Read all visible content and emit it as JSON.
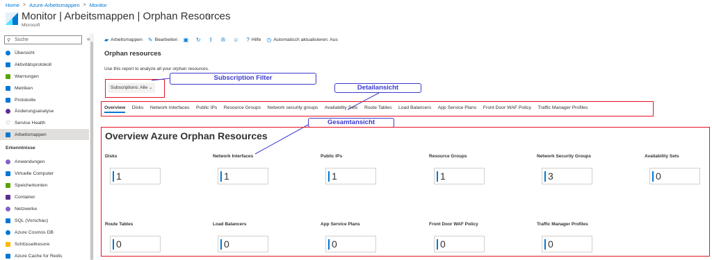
{
  "breadcrumb": [
    "Home",
    "Azure-Arbeitsmappen",
    "Monitor"
  ],
  "header": {
    "title": "Monitor | Arbeitsmappen | Orphan Resources",
    "subtitle": "Microsoft"
  },
  "sidebar": {
    "search_placeholder": "Suche",
    "items": [
      {
        "label": "Übersicht",
        "icon": "overview-icon",
        "color": "#0078d4"
      },
      {
        "label": "Aktivitätsprotokoll",
        "icon": "activity-log-icon",
        "color": "#0078d4"
      },
      {
        "label": "Warnungen",
        "icon": "alerts-icon",
        "color": "#57a300"
      },
      {
        "label": "Metriken",
        "icon": "metrics-icon",
        "color": "#0078d4"
      },
      {
        "label": "Protokolle",
        "icon": "logs-icon",
        "color": "#0078d4"
      },
      {
        "label": "Änderungsanalyse",
        "icon": "change-analysis-icon",
        "color": "#5c2d91"
      },
      {
        "label": "Service Health",
        "icon": "heart-icon",
        "color": "#605e5c"
      },
      {
        "label": "Arbeitsmappen",
        "icon": "workbooks-icon",
        "color": "#0078d4"
      }
    ],
    "section_label": "Erkenntnisse",
    "insights": [
      {
        "label": "Anwendungen",
        "icon": "application-icon",
        "color": "#8661c5"
      },
      {
        "label": "Virtuelle Computer",
        "icon": "vm-icon",
        "color": "#0078d4"
      },
      {
        "label": "Speicherkonten",
        "icon": "storage-icon",
        "color": "#57a300"
      },
      {
        "label": "Container",
        "icon": "container-icon",
        "color": "#5c2d91"
      },
      {
        "label": "Netzwerke",
        "icon": "network-icon",
        "color": "#8661c5"
      },
      {
        "label": "SQL (Vorschau)",
        "icon": "sql-icon",
        "color": "#0078d4"
      },
      {
        "label": "Azure Cosmos DB",
        "icon": "cosmos-icon",
        "color": "#0078d4"
      },
      {
        "label": "Schlüsseltresore",
        "icon": "key-icon",
        "color": "#ffb900"
      },
      {
        "label": "Azure Cache for Redis",
        "icon": "redis-icon",
        "color": "#0078d4"
      }
    ]
  },
  "toolbar": {
    "workbooks": "Arbeitsmappen",
    "edit": "Bearbeiten",
    "help": "Hilfe",
    "auto_refresh": "Automatisch aktualisieren: Aus"
  },
  "page": {
    "title": "Orphan resources",
    "description": "Use this report to analyze all your orphan resources.",
    "subscriptions": "Subscriptions: Alle"
  },
  "callouts": {
    "subscription_filter": "Subscription Filter",
    "detail_view": "Detailansicht",
    "overall_view": "Gesamtansicht"
  },
  "tabs": [
    "Overview",
    "Disks",
    "Network Interfaces",
    "Public IPs",
    "Resource Groups",
    "Network security groups",
    "Availability Sets",
    "Route Tables",
    "Load Balancers",
    "App Service Plans",
    "Front Door WAF Policy",
    "Traffic Manager Profiles"
  ],
  "overview": {
    "title": "Overview Azure Orphan Resources",
    "tiles": [
      {
        "label": "Disks",
        "value": "1"
      },
      {
        "label": "Network Interfaces",
        "value": "1"
      },
      {
        "label": "Public IPs",
        "value": "1"
      },
      {
        "label": "Resource Groups",
        "value": "1"
      },
      {
        "label": "Network Security Groups",
        "value": "3"
      },
      {
        "label": "Availability Sets",
        "value": "0"
      },
      {
        "label": "Route Tables",
        "value": "0"
      },
      {
        "label": "Load Balancers",
        "value": "0"
      },
      {
        "label": "App Service Plans",
        "value": "0"
      },
      {
        "label": "Front Door WAF Policy",
        "value": "0"
      },
      {
        "label": "Traffic Manager Profiles",
        "value": "0"
      }
    ]
  },
  "colors": {
    "accent": "#0078d4",
    "highlight": "#e81123",
    "callout": "#3a3ad0"
  }
}
